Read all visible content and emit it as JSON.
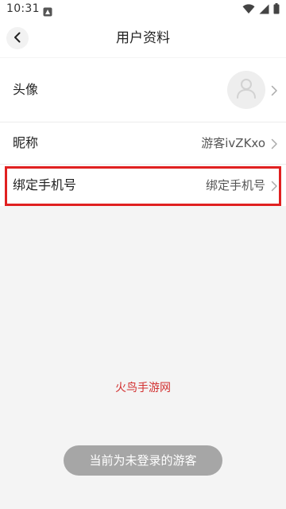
{
  "status_bar": {
    "time": "10:31",
    "app_icon": "notification-app-icon",
    "icons": [
      "wifi-icon",
      "signal-icon",
      "battery-icon"
    ]
  },
  "header": {
    "title": "用户资料",
    "back_icon": "chevron-left-icon"
  },
  "profile": {
    "avatar_label": "头像",
    "avatar_icon": "default-avatar-icon",
    "nickname_label": "昵称",
    "nickname_value": "游客ivZKxo",
    "phone_label": "绑定手机号",
    "phone_value": "绑定手机号"
  },
  "watermark": "火鸟手游网",
  "toast": "当前为未登录的游客",
  "colors": {
    "highlight": "#e02020",
    "watermark": "#d23030",
    "toast_bg": "#a6a6a6",
    "page_bg": "#f4f4f4"
  }
}
